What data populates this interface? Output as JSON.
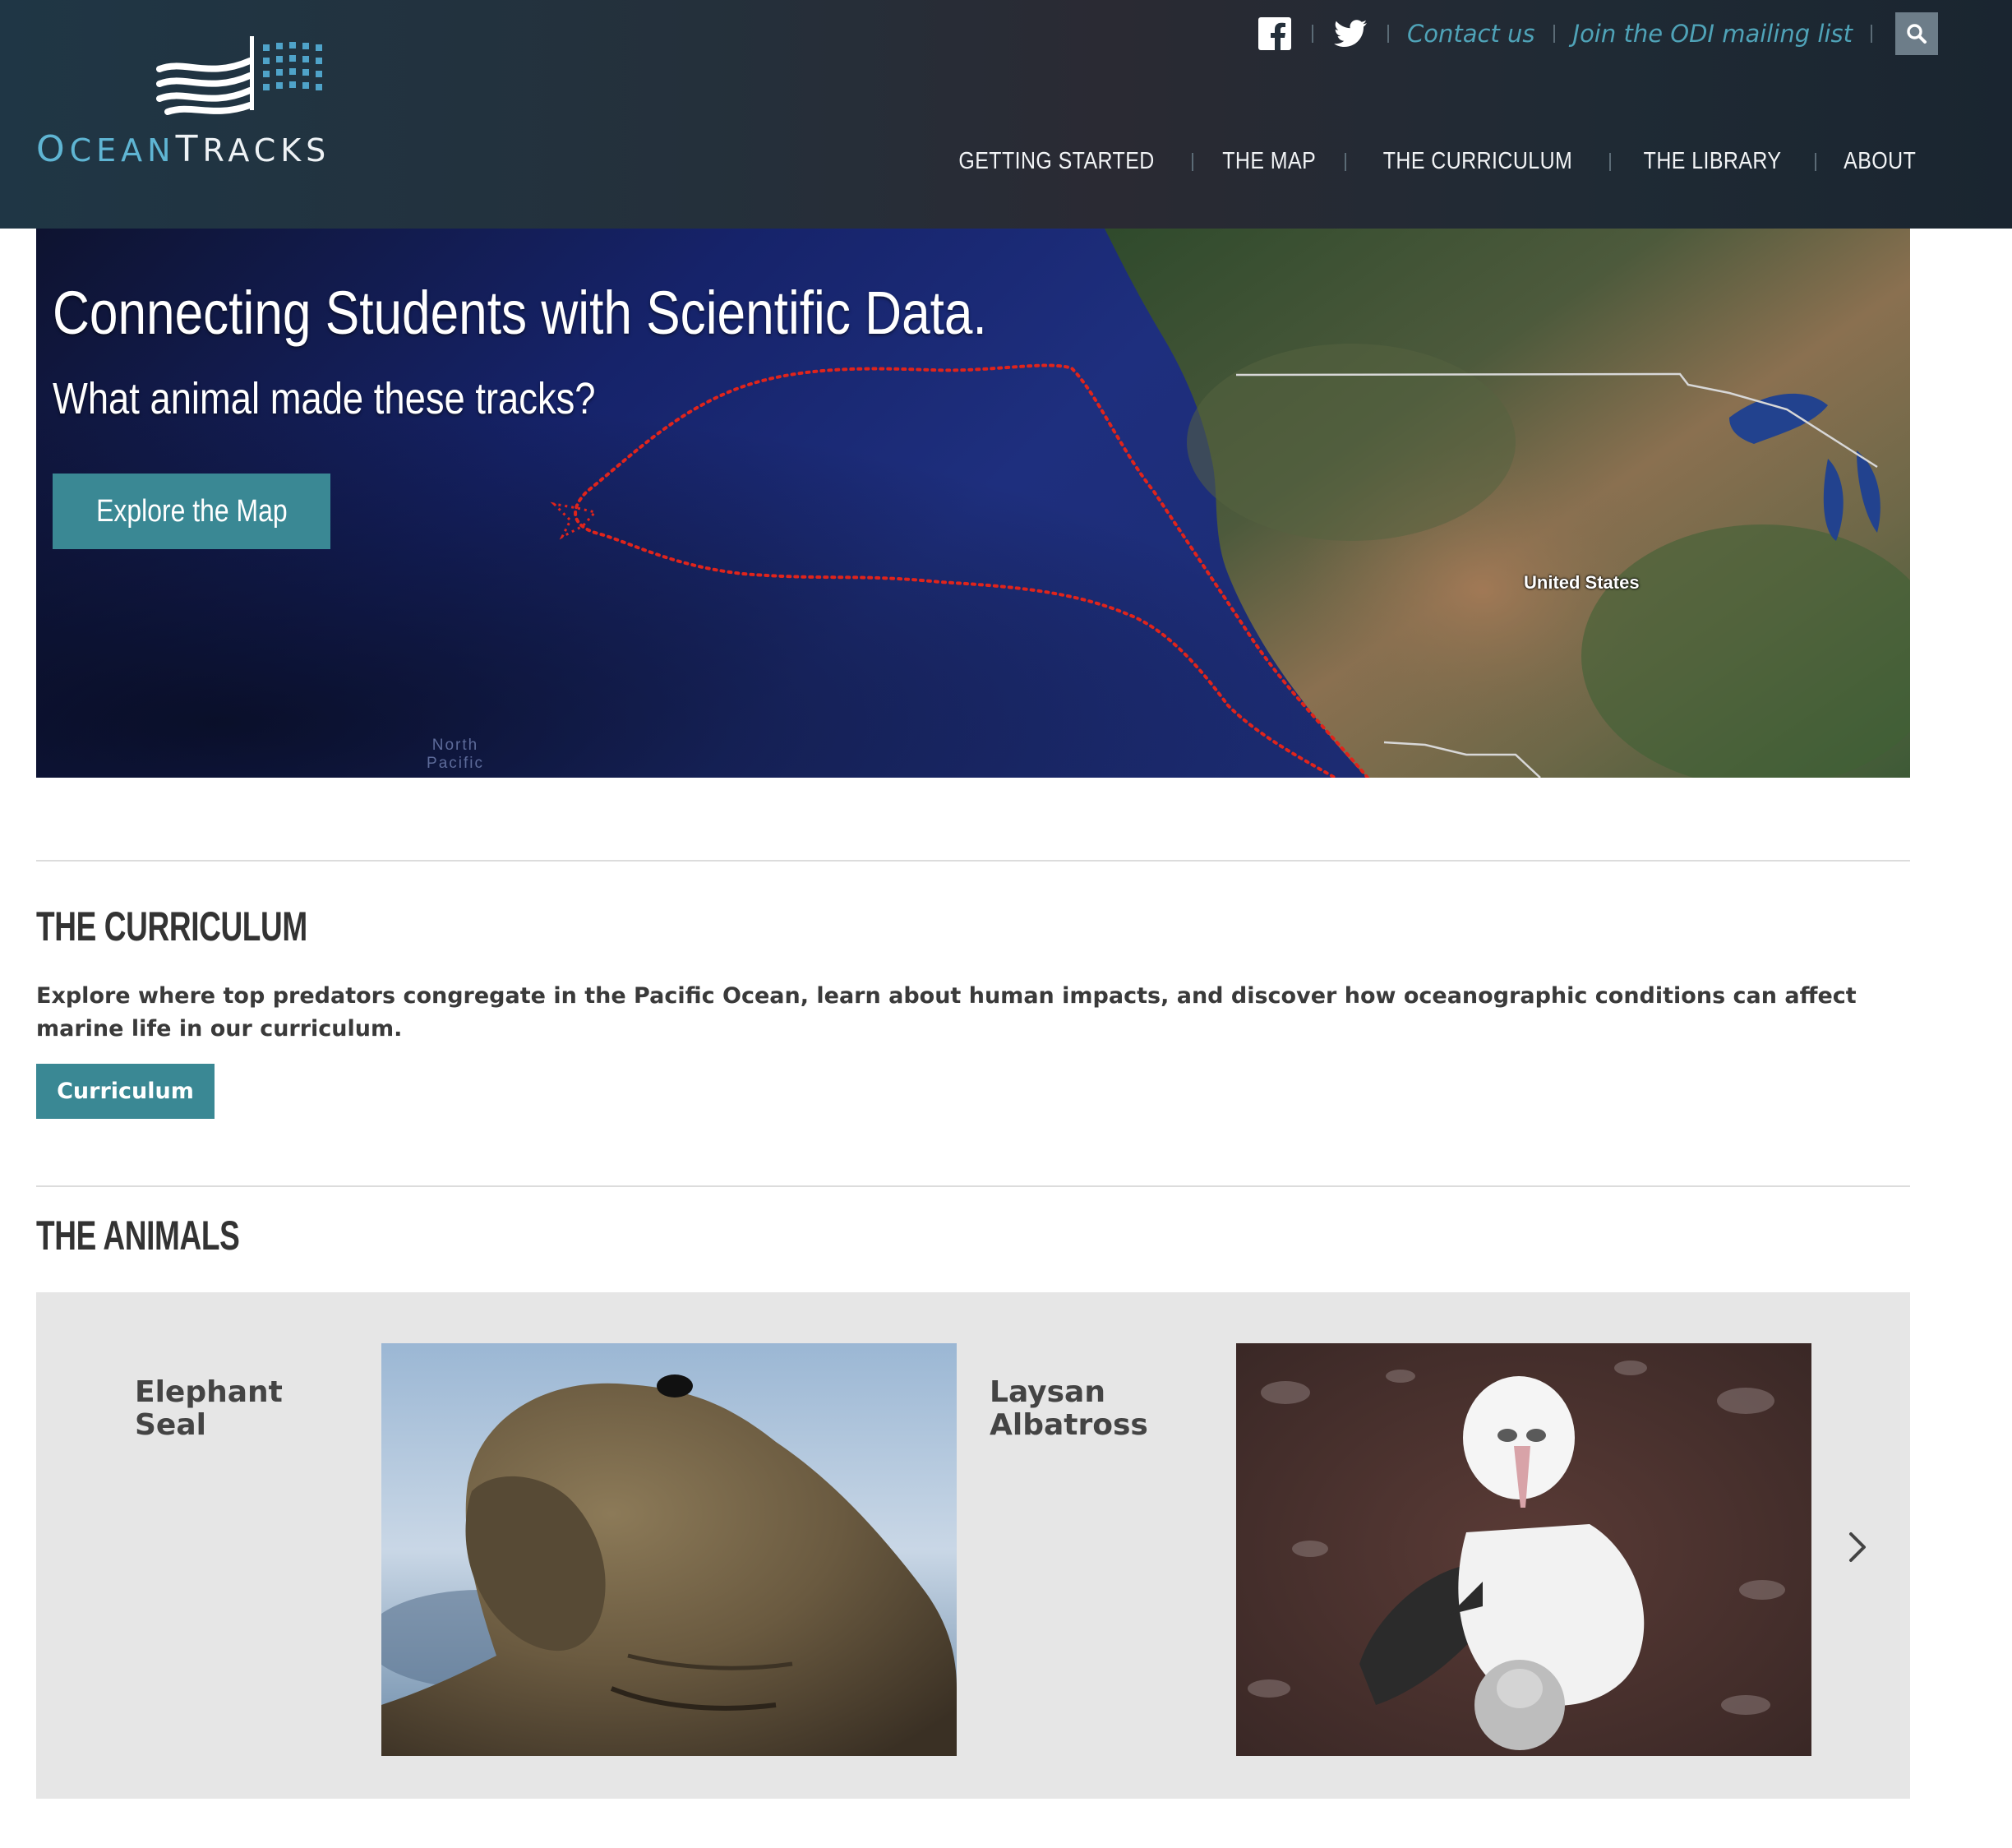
{
  "brand": {
    "logo_first_letter": "O",
    "logo_part1": "CEAN",
    "logo_second_letter": "T",
    "logo_part2": "RACKS",
    "logo_alt": "OceanTracks",
    "accent_color": "#5fb5d3",
    "button_color": "#3a8894"
  },
  "top_links": {
    "facebook_icon": "facebook-icon",
    "twitter_icon": "twitter-icon",
    "contact": "Contact us",
    "mailing": "Join the ODI mailing list",
    "search_icon": "search-icon"
  },
  "nav": {
    "items": [
      {
        "label": "GETTING STARTED"
      },
      {
        "label": "THE MAP"
      },
      {
        "label": "THE CURRICULUM"
      },
      {
        "label": "THE LIBRARY"
      },
      {
        "label": "ABOUT"
      }
    ]
  },
  "hero": {
    "title": "Connecting Students with Scientific Data.",
    "subtitle": "What animal made these tracks?",
    "button": "Explore the Map",
    "map_label_country": "United States",
    "map_label_ocean": "North Pacific"
  },
  "curriculum": {
    "heading": "THE CURRICULUM",
    "text": "Explore where top predators congregate in the Pacific Ocean, learn about human impacts, and discover how oceanographic conditions can affect marine life in our curriculum.",
    "button": "Curriculum"
  },
  "animals": {
    "heading": "THE ANIMALS",
    "items": [
      {
        "name": "Elephant Seal"
      },
      {
        "name": "Laysan Albatross"
      }
    ],
    "next_icon": "chevron-right-icon"
  }
}
